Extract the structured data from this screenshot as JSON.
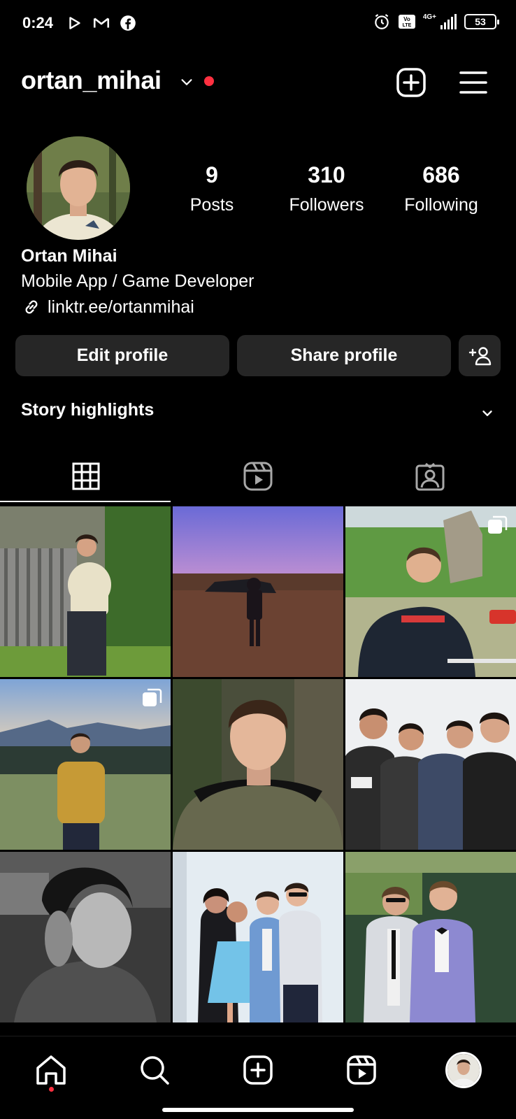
{
  "status_bar": {
    "time": "0:24",
    "network": "4G+",
    "volte": "Vo LTE",
    "battery": "53"
  },
  "header": {
    "username": "ortan_mihai"
  },
  "profile": {
    "stats": [
      {
        "value": "9",
        "label": "Posts"
      },
      {
        "value": "310",
        "label": "Followers"
      },
      {
        "value": "686",
        "label": "Following"
      }
    ],
    "name": "Ortan Mihai",
    "bio": "Mobile App / Game Developer",
    "link": "linktr.ee/ortanmihai"
  },
  "actions": {
    "edit_label": "Edit profile",
    "share_label": "Share profile"
  },
  "highlights": {
    "label": "Story highlights"
  },
  "tabs": [
    "grid-icon",
    "reels-icon",
    "tagged-icon"
  ],
  "grid_posts": [
    {
      "scene": "forest-fence-standing",
      "multi": false
    },
    {
      "scene": "sunset-field-car",
      "multi": false
    },
    {
      "scene": "river-cliff-hoodie",
      "multi": true
    },
    {
      "scene": "mountain-yellow-hoodie",
      "multi": true
    },
    {
      "scene": "portrait-tshirt",
      "multi": false
    },
    {
      "scene": "group-of-four",
      "multi": false
    },
    {
      "scene": "bw-portrait",
      "multi": false
    },
    {
      "scene": "prom-group",
      "multi": false
    },
    {
      "scene": "two-in-suits",
      "multi": false
    }
  ],
  "bottom_nav": [
    "home-icon",
    "search-icon",
    "create-icon",
    "reels-icon",
    "profile-avatar"
  ],
  "colors": {
    "background": "#000000",
    "button_bg": "#262626",
    "notification_red": "#ff3040"
  }
}
